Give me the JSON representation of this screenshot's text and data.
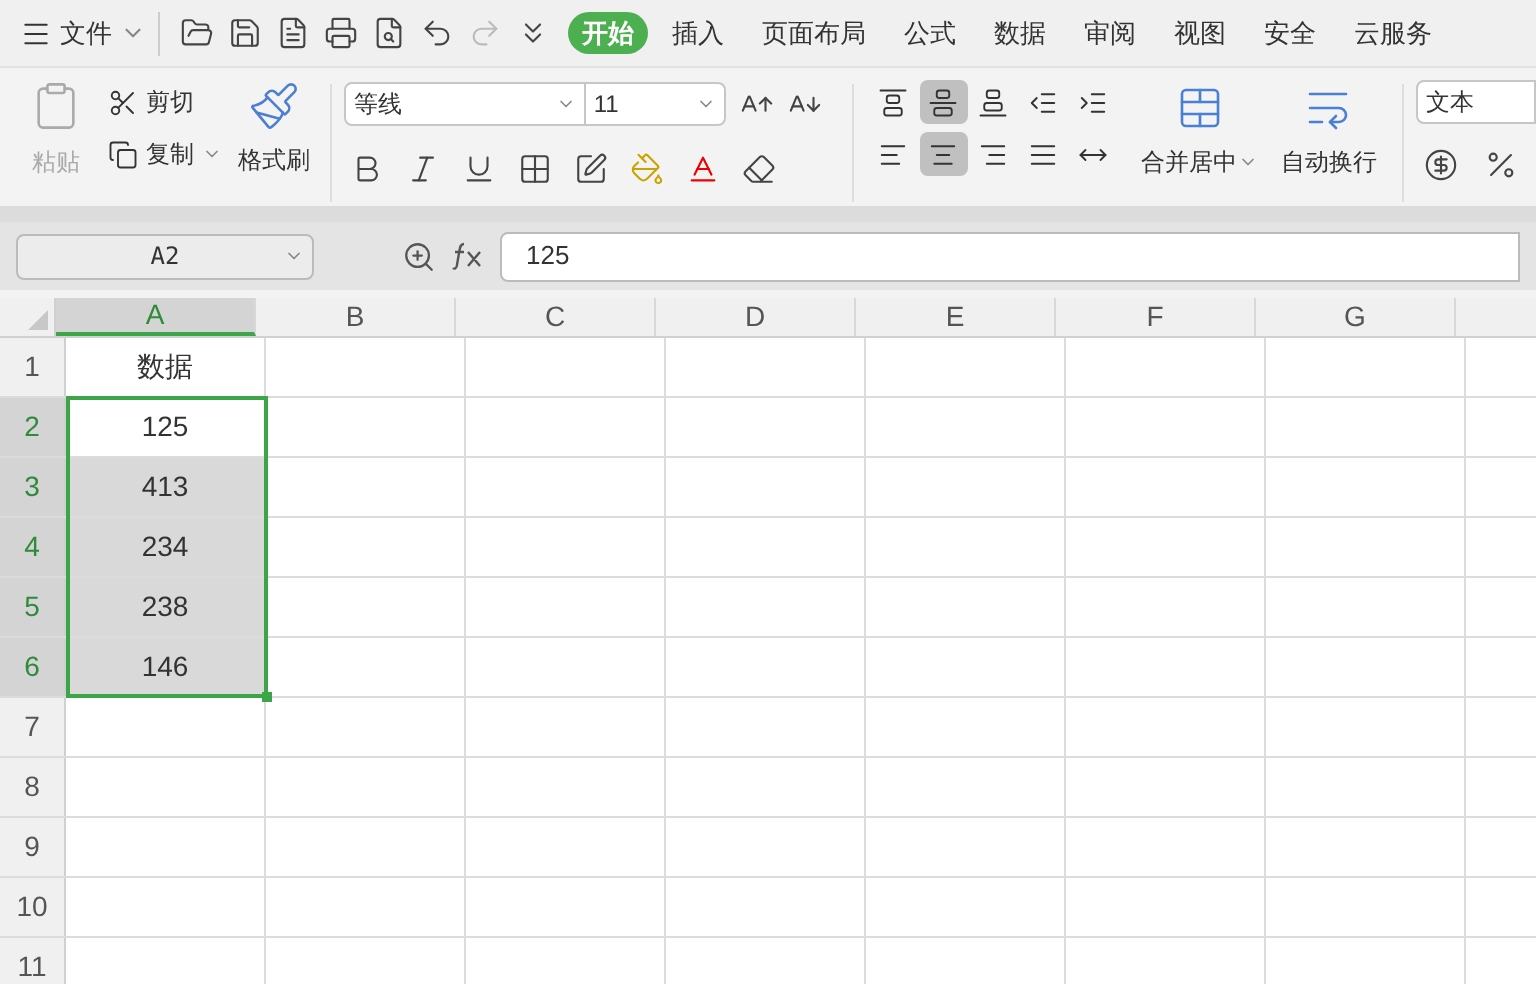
{
  "menu": {
    "file_label": "文件"
  },
  "tabs": [
    {
      "label": "开始",
      "selected": true
    },
    {
      "label": "插入",
      "selected": false
    },
    {
      "label": "页面布局",
      "selected": false
    },
    {
      "label": "公式",
      "selected": false
    },
    {
      "label": "数据",
      "selected": false
    },
    {
      "label": "审阅",
      "selected": false
    },
    {
      "label": "视图",
      "selected": false
    },
    {
      "label": "安全",
      "selected": false
    },
    {
      "label": "云服务",
      "selected": false
    }
  ],
  "ribbon": {
    "paste": {
      "label": "粘贴",
      "disabled": true
    },
    "cut": "剪切",
    "copy": "复制",
    "format_painter": "格式刷",
    "font_name": "等线",
    "font_size": "11",
    "align_buttons": [
      {
        "kind": "top",
        "selected": false
      },
      {
        "kind": "middle",
        "selected": true
      },
      {
        "kind": "bottom",
        "selected": false
      },
      {
        "kind": "outdent",
        "selected": false
      },
      {
        "kind": "indent",
        "selected": false
      },
      {
        "kind": "left",
        "selected": false
      },
      {
        "kind": "center",
        "selected": true
      },
      {
        "kind": "right",
        "selected": false
      },
      {
        "kind": "justify",
        "selected": false
      },
      {
        "kind": "distribute",
        "selected": false
      }
    ],
    "merge": "合并居中",
    "wrap": "自动换行",
    "number_format": "文本"
  },
  "formula_bar": {
    "name_box": "A2",
    "value": "125"
  },
  "columns": [
    {
      "label": "A",
      "selected": true
    },
    {
      "label": "B",
      "selected": false
    },
    {
      "label": "C",
      "selected": false
    },
    {
      "label": "D",
      "selected": false
    },
    {
      "label": "E",
      "selected": false
    },
    {
      "label": "F",
      "selected": false
    },
    {
      "label": "G",
      "selected": false
    }
  ],
  "rows": [
    {
      "label": "1",
      "selected": false,
      "cell_a": "数据"
    },
    {
      "label": "2",
      "selected": true,
      "cell_a": "125",
      "active": true
    },
    {
      "label": "3",
      "selected": true,
      "cell_a": "413"
    },
    {
      "label": "4",
      "selected": true,
      "cell_a": "234"
    },
    {
      "label": "5",
      "selected": true,
      "cell_a": "238"
    },
    {
      "label": "6",
      "selected": true,
      "cell_a": "146"
    },
    {
      "label": "7",
      "selected": false
    },
    {
      "label": "8",
      "selected": false
    },
    {
      "label": "9",
      "selected": false
    },
    {
      "label": "10",
      "selected": false
    },
    {
      "label": "11",
      "selected": false
    }
  ]
}
